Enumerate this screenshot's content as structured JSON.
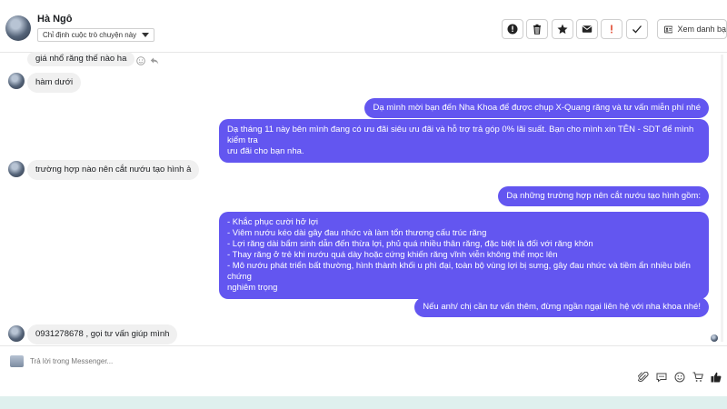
{
  "header": {
    "contact_name": "Hà Ngô",
    "assign_label": "Chỉ định cuộc trò chuyện này",
    "view_more_label": "Xem danh bạ",
    "tools": [
      "info-icon",
      "trash-icon",
      "star-icon",
      "mail-icon",
      "exclamation-icon",
      "check-icon"
    ]
  },
  "messages": {
    "m1": "giá nhổ răng thế nào ha",
    "m2": "hàm dưới",
    "m3": "Dạ mình mời bạn đến Nha Khoa để được chụp X-Quang răng và tư vấn miễn phí nhé",
    "m4": [
      "Dạ tháng 11 này bên mình đang có ưu đãi siêu ưu đãi và hỗ trợ trả góp 0% lãi suất. Bạn cho mình xin TÊN - SDT để mình kiểm tra",
      "ưu đãi cho bạn nha."
    ],
    "m5": "trường hợp nào nên cắt nướu tạo hình ả",
    "m6": "Dạ những trường hợp nên cắt nướu tạo hình gồm:",
    "m7": [
      "- Khắc phục cười hở lợi",
      "- Viêm nướu kéo dài gây đau nhức và làm tổn thương cấu trúc răng",
      "- Lợi răng dài bẩm sinh dẫn đến thừa lợi, phủ quá nhiều thân răng, đặc biệt là đối với răng khôn",
      "- Thay răng ở trẻ khi nướu quá dày hoặc cứng khiến răng vĩnh viễn không thể mọc lên",
      "- Mô nướu phát triển bất thường, hình thành khối u phì đại, toàn bộ vùng lợi bị sưng, gây đau nhức và tiềm ẩn nhiều biến chứng",
      "nghiêm trọng"
    ],
    "m8": "Nếu anh/ chị cần tư vấn thêm, đừng ngần ngại liên hệ với nha khoa nhé!",
    "m9": "0931278678 , gọi tư vấn giúp mình"
  },
  "composer": {
    "placeholder": "Trả lời trong Messenger...",
    "tools": [
      "attachment-icon",
      "chat-template-icon",
      "emoji-icon",
      "cart-icon",
      "thumbs-up-icon"
    ]
  },
  "colors": {
    "outgoing_bubble": "#6356f0",
    "incoming_bubble": "#f0f0f0",
    "footer_strip": "#dff0ee"
  }
}
